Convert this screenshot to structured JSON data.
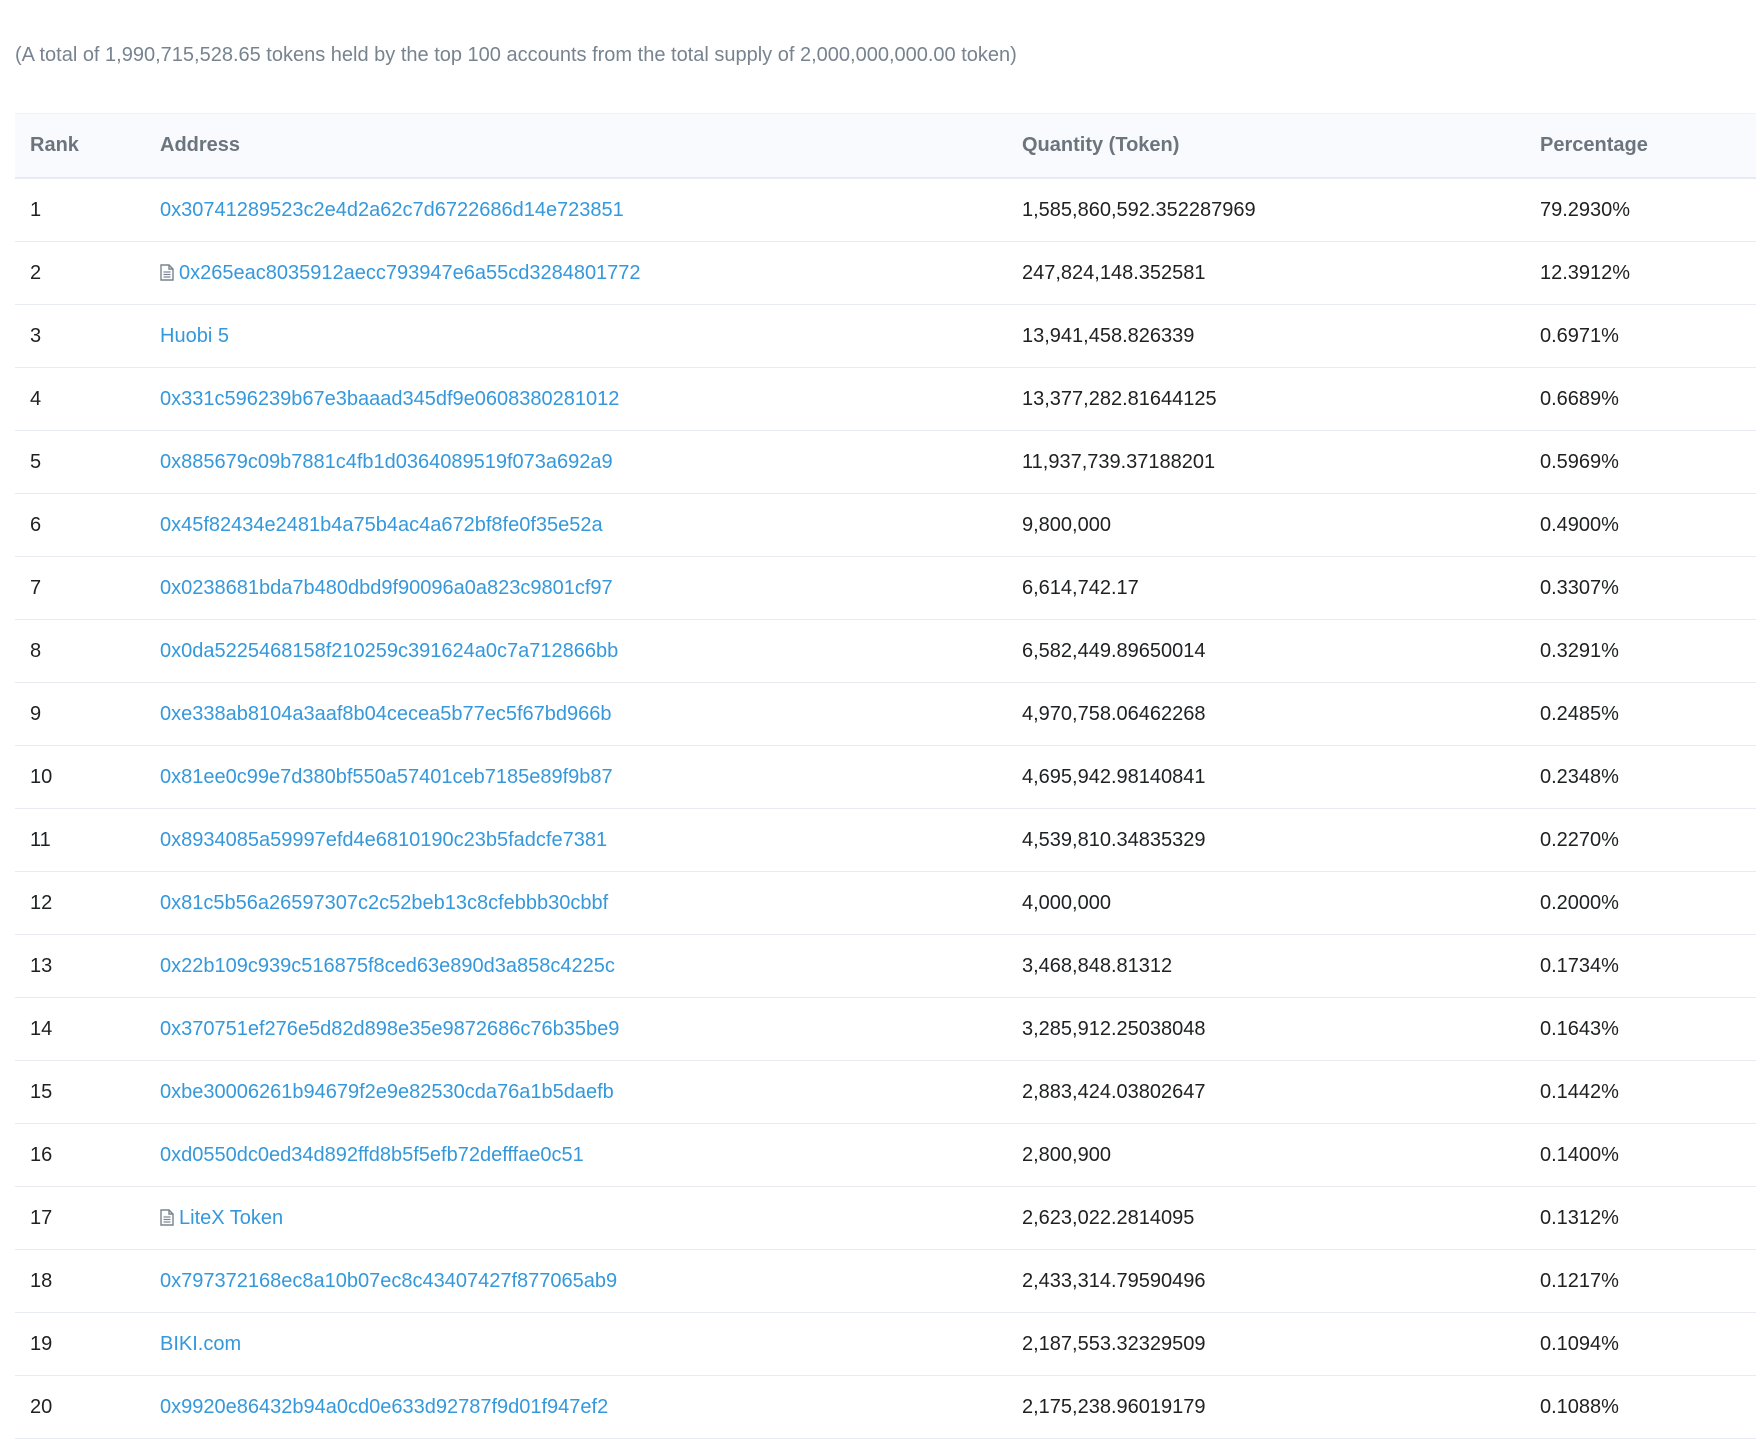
{
  "summary_text": "(A total of 1,990,715,528.65 tokens held by the top 100 accounts from the total supply of 2,000,000,000.00 token)",
  "columns": {
    "rank": "Rank",
    "address": "Address",
    "quantity": "Quantity (Token)",
    "percentage": "Percentage"
  },
  "rows": [
    {
      "rank": "1",
      "address": "0x30741289523c2e4d2a62c7d6722686d14e723851",
      "contract": false,
      "quantity": "1,585,860,592.352287969",
      "percentage": "79.2930%"
    },
    {
      "rank": "2",
      "address": "0x265eac8035912aecc793947e6a55cd3284801772",
      "contract": true,
      "quantity": "247,824,148.352581",
      "percentage": "12.3912%"
    },
    {
      "rank": "3",
      "address": "Huobi 5",
      "contract": false,
      "quantity": "13,941,458.826339",
      "percentage": "0.6971%"
    },
    {
      "rank": "4",
      "address": "0x331c596239b67e3baaad345df9e0608380281012",
      "contract": false,
      "quantity": "13,377,282.81644125",
      "percentage": "0.6689%"
    },
    {
      "rank": "5",
      "address": "0x885679c09b7881c4fb1d0364089519f073a692a9",
      "contract": false,
      "quantity": "11,937,739.37188201",
      "percentage": "0.5969%"
    },
    {
      "rank": "6",
      "address": "0x45f82434e2481b4a75b4ac4a672bf8fe0f35e52a",
      "contract": false,
      "quantity": "9,800,000",
      "percentage": "0.4900%"
    },
    {
      "rank": "7",
      "address": "0x0238681bda7b480dbd9f90096a0a823c9801cf97",
      "contract": false,
      "quantity": "6,614,742.17",
      "percentage": "0.3307%"
    },
    {
      "rank": "8",
      "address": "0x0da5225468158f210259c391624a0c7a712866bb",
      "contract": false,
      "quantity": "6,582,449.89650014",
      "percentage": "0.3291%"
    },
    {
      "rank": "9",
      "address": "0xe338ab8104a3aaf8b04cecea5b77ec5f67bd966b",
      "contract": false,
      "quantity": "4,970,758.06462268",
      "percentage": "0.2485%"
    },
    {
      "rank": "10",
      "address": "0x81ee0c99e7d380bf550a57401ceb7185e89f9b87",
      "contract": false,
      "quantity": "4,695,942.98140841",
      "percentage": "0.2348%"
    },
    {
      "rank": "11",
      "address": "0x8934085a59997efd4e6810190c23b5fadcfe7381",
      "contract": false,
      "quantity": "4,539,810.34835329",
      "percentage": "0.2270%"
    },
    {
      "rank": "12",
      "address": "0x81c5b56a26597307c2c52beb13c8cfebbb30cbbf",
      "contract": false,
      "quantity": "4,000,000",
      "percentage": "0.2000%"
    },
    {
      "rank": "13",
      "address": "0x22b109c939c516875f8ced63e890d3a858c4225c",
      "contract": false,
      "quantity": "3,468,848.81312",
      "percentage": "0.1734%"
    },
    {
      "rank": "14",
      "address": "0x370751ef276e5d82d898e35e9872686c76b35be9",
      "contract": false,
      "quantity": "3,285,912.25038048",
      "percentage": "0.1643%"
    },
    {
      "rank": "15",
      "address": "0xbe30006261b94679f2e9e82530cda76a1b5daefb",
      "contract": false,
      "quantity": "2,883,424.03802647",
      "percentage": "0.1442%"
    },
    {
      "rank": "16",
      "address": "0xd0550dc0ed34d892ffd8b5f5efb72defffae0c51",
      "contract": false,
      "quantity": "2,800,900",
      "percentage": "0.1400%"
    },
    {
      "rank": "17",
      "address": "LiteX Token",
      "contract": true,
      "quantity": "2,623,022.2814095",
      "percentage": "0.1312%"
    },
    {
      "rank": "18",
      "address": "0x797372168ec8a10b07ec8c43407427f877065ab9",
      "contract": false,
      "quantity": "2,433,314.79590496",
      "percentage": "0.1217%"
    },
    {
      "rank": "19",
      "address": "BIKI.com",
      "contract": false,
      "quantity": "2,187,553.32329509",
      "percentage": "0.1094%"
    },
    {
      "rank": "20",
      "address": "0x9920e86432b94a0cd0e633d92787f9d01f947ef2",
      "contract": false,
      "quantity": "2,175,238.96019179",
      "percentage": "0.1088%"
    }
  ],
  "icons": {
    "contract": "file-contract-icon"
  },
  "colors": {
    "link": "#3498db",
    "muted": "#77838f",
    "header_bg": "#f8fafd",
    "border": "#e7eaf3"
  }
}
